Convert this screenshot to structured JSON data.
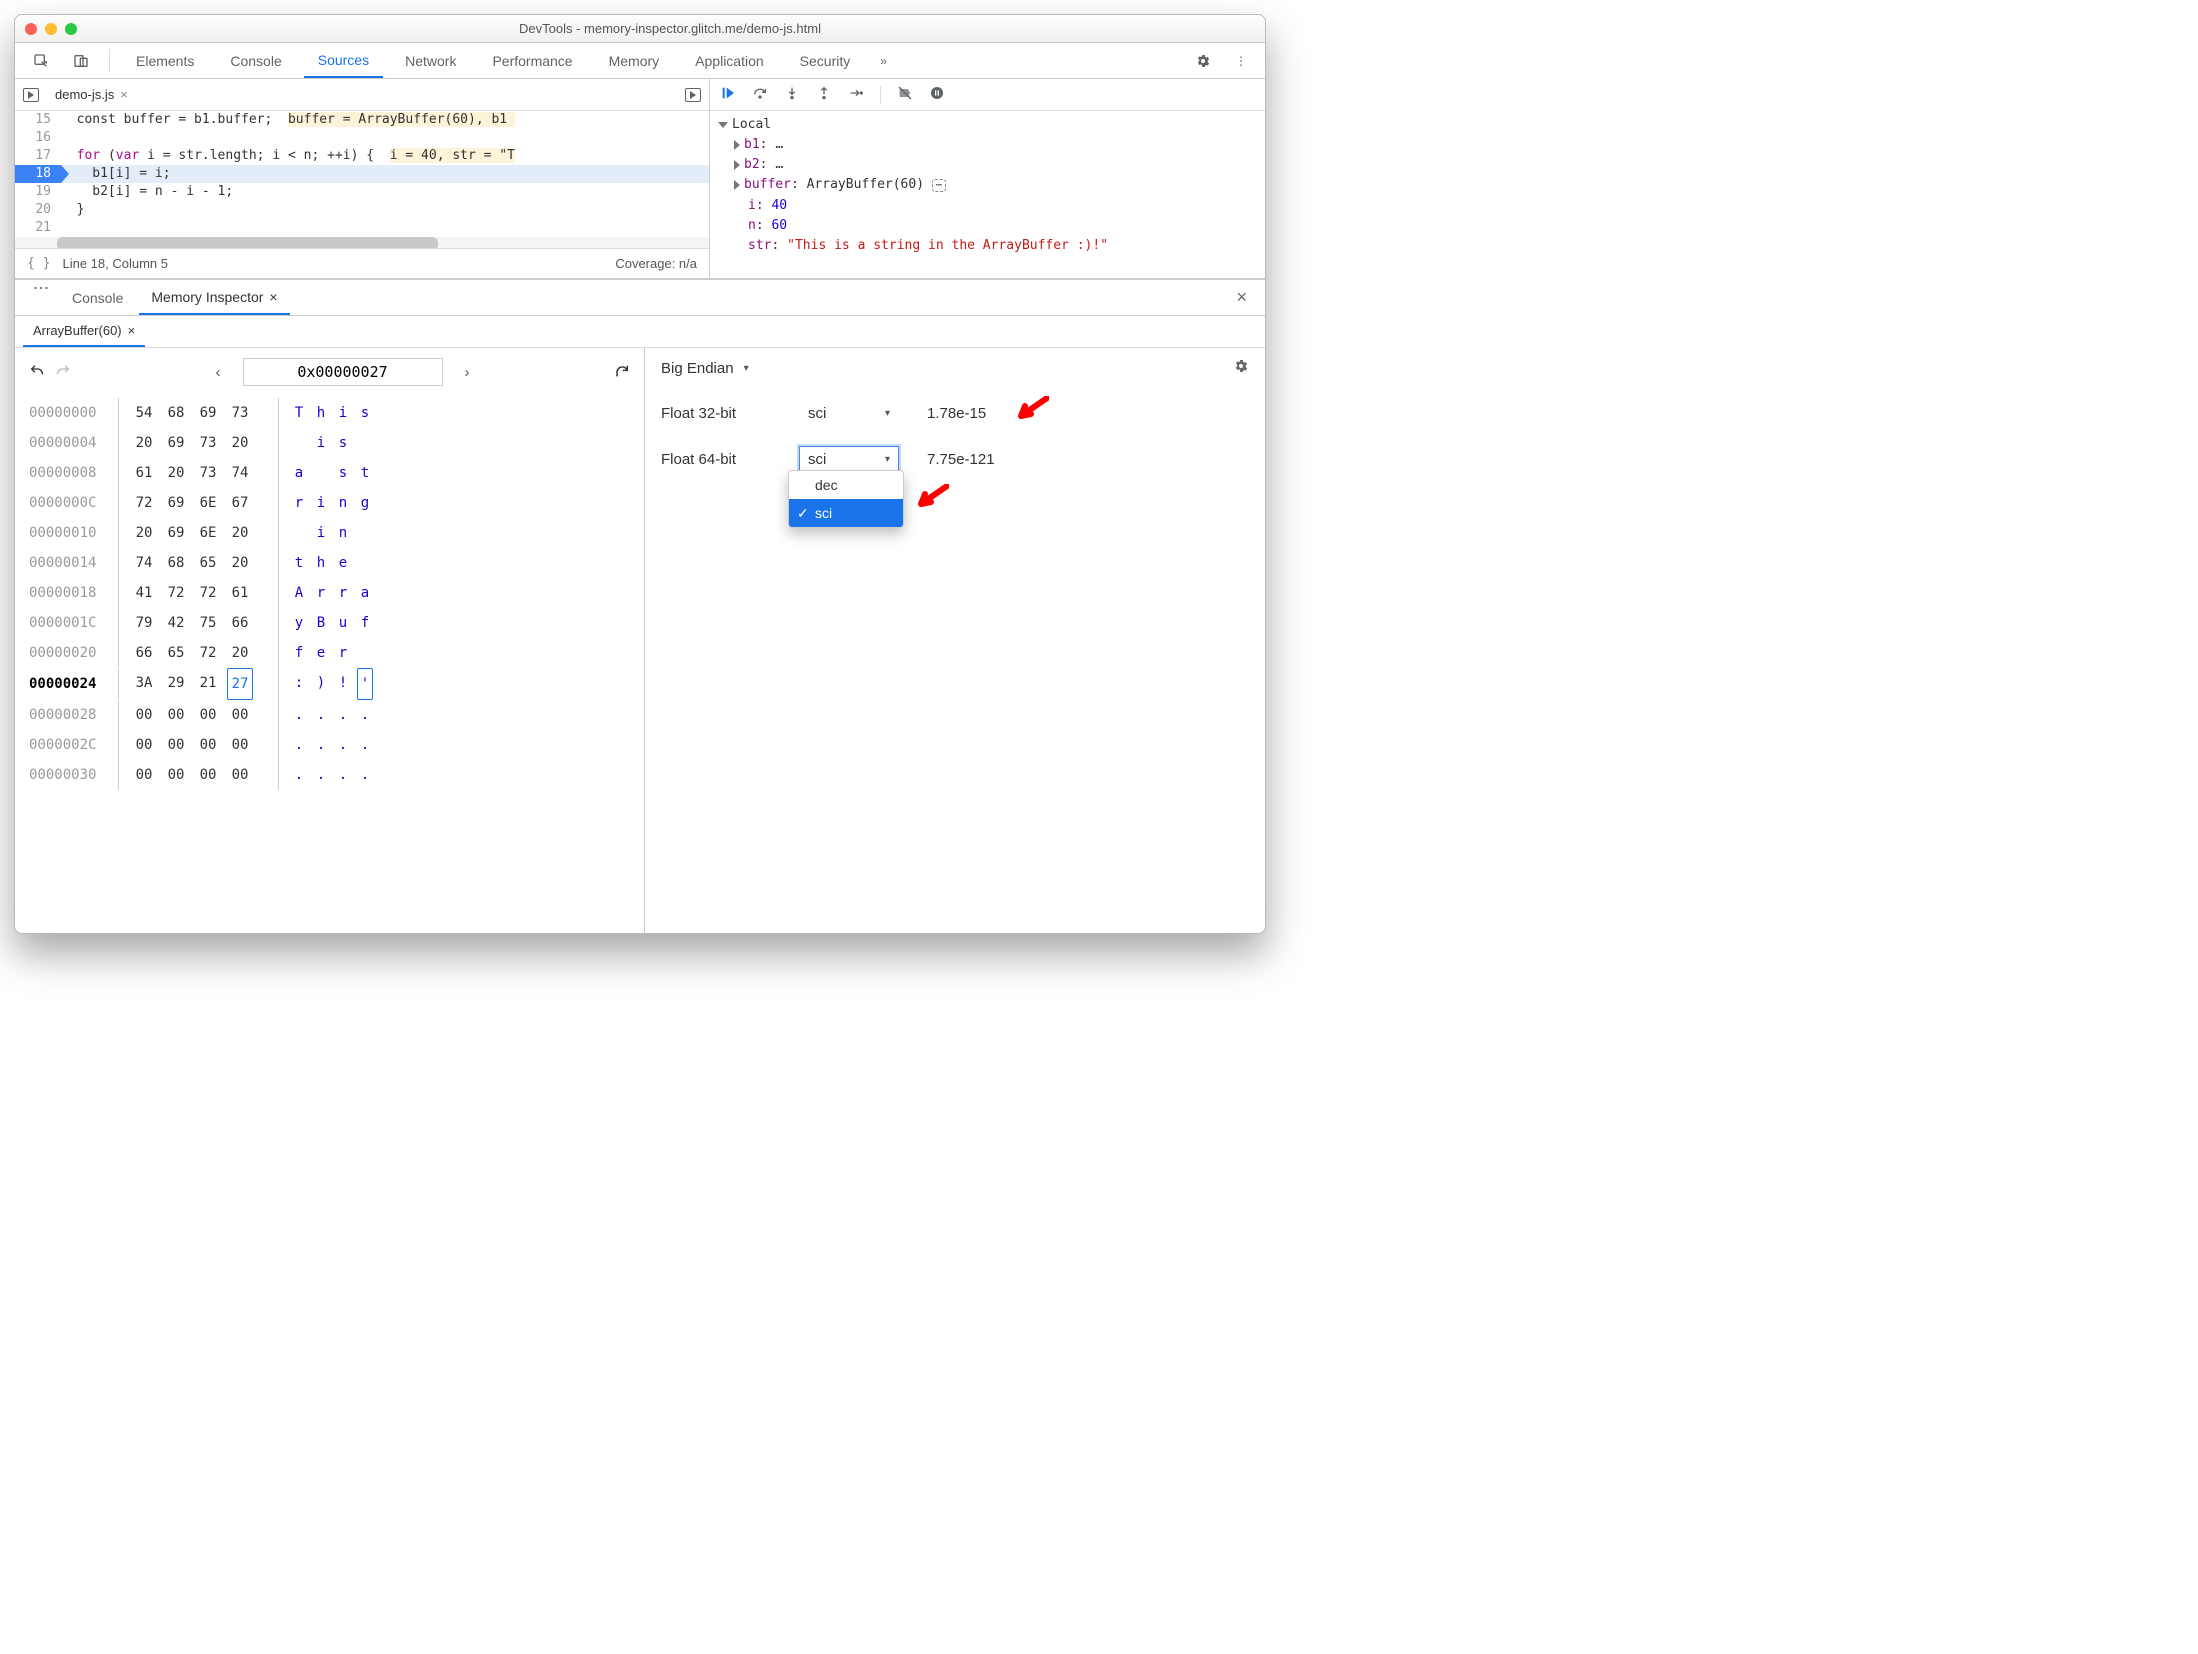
{
  "title": "DevTools - memory-inspector.glitch.me/demo-js.html",
  "tabs": [
    "Elements",
    "Console",
    "Sources",
    "Network",
    "Performance",
    "Memory",
    "Application",
    "Security"
  ],
  "active_tab": "Sources",
  "file_tab": "demo-js.js",
  "code": {
    "l15_n": "15",
    "l15": "const buffer = b1.buffer;  ",
    "l15_hint": "buffer = ArrayBuffer(60), b1 ",
    "l16_n": "16",
    "l16": "",
    "l17_n": "17",
    "l17_a": "for",
    "l17_b": " (",
    "l17_c": "var",
    "l17_d": " i = str.length; i < n; ++i) {  ",
    "l17_hint": "i = 40, str = \"T",
    "l18_n": "18",
    "l18": "    b1[i] = i;",
    "l19_n": "19",
    "l19": "    b2[i] = n - i - 1;",
    "l20_n": "20",
    "l20": "  }",
    "l21_n": "21",
    "l21": ""
  },
  "status_pos": "Line 18, Column 5",
  "status_cov": "Coverage: n/a",
  "scope": {
    "header": "Local",
    "b1": "b1",
    "b1v": "…",
    "b2": "b2",
    "b2v": "…",
    "buffer": "buffer",
    "bufferv": "ArrayBuffer(60)",
    "i": "i",
    "iv": "40",
    "n": "n",
    "nv": "60",
    "str": "str",
    "strv": "\"This is a string in the ArrayBuffer :)!\""
  },
  "drawer_tabs": {
    "console": "Console",
    "mi": "Memory Inspector"
  },
  "mi_tab": "ArrayBuffer(60)",
  "address": "0x00000027",
  "hex": [
    {
      "addr": "00000000",
      "b": [
        "54",
        "68",
        "69",
        "73"
      ],
      "a": [
        "T",
        "h",
        "i",
        "s"
      ]
    },
    {
      "addr": "00000004",
      "b": [
        "20",
        "69",
        "73",
        "20"
      ],
      "a": [
        " ",
        "i",
        "s",
        " "
      ]
    },
    {
      "addr": "00000008",
      "b": [
        "61",
        "20",
        "73",
        "74"
      ],
      "a": [
        "a",
        " ",
        "s",
        "t"
      ]
    },
    {
      "addr": "0000000C",
      "b": [
        "72",
        "69",
        "6E",
        "67"
      ],
      "a": [
        "r",
        "i",
        "n",
        "g"
      ]
    },
    {
      "addr": "00000010",
      "b": [
        "20",
        "69",
        "6E",
        "20"
      ],
      "a": [
        " ",
        "i",
        "n",
        " "
      ]
    },
    {
      "addr": "00000014",
      "b": [
        "74",
        "68",
        "65",
        "20"
      ],
      "a": [
        "t",
        "h",
        "e",
        " "
      ]
    },
    {
      "addr": "00000018",
      "b": [
        "41",
        "72",
        "72",
        "61"
      ],
      "a": [
        "A",
        "r",
        "r",
        "a"
      ]
    },
    {
      "addr": "0000001C",
      "b": [
        "79",
        "42",
        "75",
        "66"
      ],
      "a": [
        "y",
        "B",
        "u",
        "f"
      ]
    },
    {
      "addr": "00000020",
      "b": [
        "66",
        "65",
        "72",
        "20"
      ],
      "a": [
        "f",
        "e",
        "r",
        " "
      ]
    },
    {
      "addr": "00000024",
      "b": [
        "3A",
        "29",
        "21",
        "27"
      ],
      "a": [
        ":",
        ")",
        "!",
        "'"
      ],
      "cur": true,
      "sel_byte": 3,
      "sel_asc": 3
    },
    {
      "addr": "00000028",
      "b": [
        "00",
        "00",
        "00",
        "00"
      ],
      "a": [
        ".",
        ".",
        ".",
        "."
      ]
    },
    {
      "addr": "0000002C",
      "b": [
        "00",
        "00",
        "00",
        "00"
      ],
      "a": [
        ".",
        ".",
        ".",
        "."
      ]
    },
    {
      "addr": "00000030",
      "b": [
        "00",
        "00",
        "00",
        "00"
      ],
      "a": [
        ".",
        ".",
        ".",
        "."
      ]
    }
  ],
  "endian": "Big Endian",
  "values": {
    "f32_label": "Float 32-bit",
    "f32_not": "sci",
    "f32_val": "1.78e-15",
    "f64_label": "Float 64-bit",
    "f64_not": "sci",
    "f64_val": "7.75e-121"
  },
  "dropdown": {
    "dec": "dec",
    "sci": "sci"
  }
}
